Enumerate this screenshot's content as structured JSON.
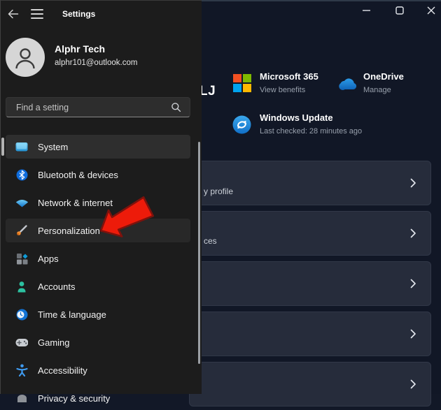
{
  "window": {
    "title": "Settings"
  },
  "profile": {
    "name": "Alphr Tech",
    "email": "alphr101@outlook.com"
  },
  "search": {
    "placeholder": "Find a setting"
  },
  "sidebar": {
    "items": [
      {
        "label": "System"
      },
      {
        "label": "Bluetooth & devices"
      },
      {
        "label": "Network & internet"
      },
      {
        "label": "Personalization"
      },
      {
        "label": "Apps"
      },
      {
        "label": "Accounts"
      },
      {
        "label": "Time & language"
      },
      {
        "label": "Gaming"
      },
      {
        "label": "Accessibility"
      },
      {
        "label": "Privacy & security"
      }
    ]
  },
  "content": {
    "heading_fragment": "LJ",
    "promos": [
      {
        "title": "Microsoft 365",
        "subtitle": "View benefits"
      },
      {
        "title": "OneDrive",
        "subtitle": "Manage"
      },
      {
        "title": "Windows Update",
        "subtitle": "Last checked: 28 minutes ago"
      }
    ],
    "rows": [
      {
        "fragment": "y profile"
      },
      {
        "fragment": "ces"
      },
      {
        "fragment": ""
      },
      {
        "fragment": ""
      },
      {
        "fragment": ""
      }
    ]
  },
  "colors": {
    "annotation_arrow_red": "#ed1b0a",
    "ms_logo_red": "#f25022",
    "ms_logo_green": "#7fba00",
    "ms_logo_blue": "#00a4ef",
    "ms_logo_yellow": "#ffb900",
    "card_bg": "#262c3b",
    "sidebar_bg": "#1c1c1c",
    "content_bg": "#111726"
  }
}
